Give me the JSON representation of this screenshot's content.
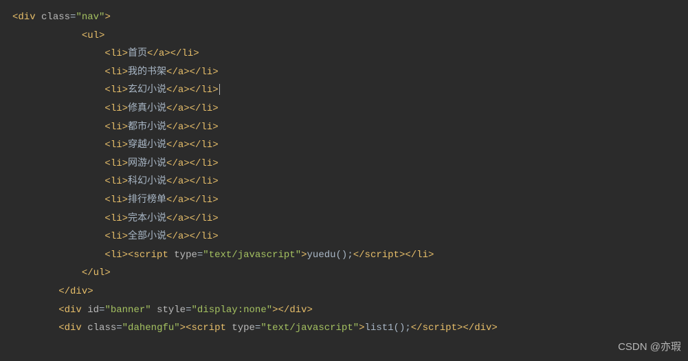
{
  "code": {
    "lines": [
      {
        "indent": 0,
        "type": "open",
        "tag": "div",
        "attrs": [
          {
            "name": "class",
            "value": "nav"
          }
        ]
      },
      {
        "indent": 3,
        "type": "open",
        "tag": "ul"
      },
      {
        "indent": 4,
        "type": "li",
        "text": "首页"
      },
      {
        "indent": 4,
        "type": "li",
        "text": "我的书架"
      },
      {
        "indent": 4,
        "type": "li",
        "text": "玄幻小说",
        "cursor": true
      },
      {
        "indent": 4,
        "type": "li",
        "text": "修真小说"
      },
      {
        "indent": 4,
        "type": "li",
        "text": "都市小说"
      },
      {
        "indent": 4,
        "type": "li",
        "text": "穿越小说"
      },
      {
        "indent": 4,
        "type": "li",
        "text": "网游小说"
      },
      {
        "indent": 4,
        "type": "li",
        "text": "科幻小说"
      },
      {
        "indent": 4,
        "type": "li",
        "text": "排行榜单"
      },
      {
        "indent": 4,
        "type": "li",
        "text": "完本小说"
      },
      {
        "indent": 4,
        "type": "li",
        "text": "全部小说"
      },
      {
        "indent": 4,
        "type": "li-script",
        "scriptType": "text/javascript",
        "scriptBody": "yuedu();"
      },
      {
        "indent": 3,
        "type": "close",
        "tag": "ul"
      },
      {
        "indent": 2,
        "type": "close",
        "tag": "div"
      },
      {
        "indent": 2,
        "type": "open-close",
        "tag": "div",
        "attrs": [
          {
            "name": "id",
            "value": "banner"
          },
          {
            "name": "style",
            "value": "display:none"
          }
        ]
      },
      {
        "indent": 2,
        "type": "div-script",
        "attrs": [
          {
            "name": "class",
            "value": "dahengfu"
          }
        ],
        "scriptType": "text/javascript",
        "scriptBody": "list1();"
      }
    ]
  },
  "watermark": "CSDN @亦瑕"
}
